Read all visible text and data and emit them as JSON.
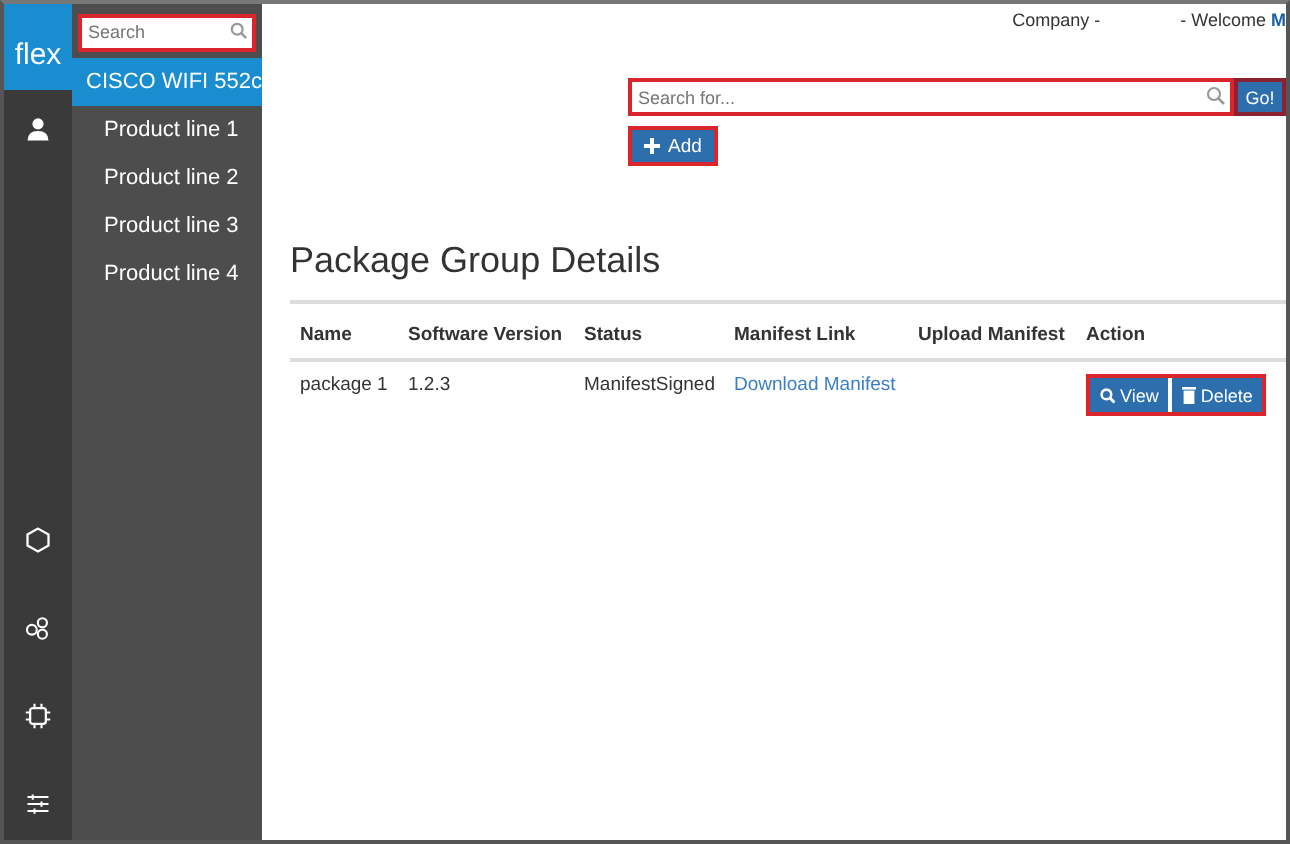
{
  "logo": "flex",
  "rail_icons": [
    {
      "kind": "person"
    },
    {
      "kind": "hexagon"
    },
    {
      "kind": "circles"
    },
    {
      "kind": "chip"
    },
    {
      "kind": "sliders"
    }
  ],
  "sidebar": {
    "search": {
      "placeholder": "Search"
    },
    "items": [
      {
        "label": "CISCO WIFI 552c",
        "selected": true
      },
      {
        "label": "Product line 1",
        "selected": false
      },
      {
        "label": "Product line 2",
        "selected": false
      },
      {
        "label": "Product line 3",
        "selected": false
      },
      {
        "label": "Product line 4",
        "selected": false
      }
    ]
  },
  "header": {
    "company": "Company -",
    "welcome": "- Welcome",
    "user": "M"
  },
  "search": {
    "placeholder": "Search for...",
    "button": "Go!"
  },
  "add_button": "Add",
  "title": "Package Group Details",
  "table": {
    "columns": [
      "Name",
      "Software Version",
      "Status",
      "Manifest Link",
      "Upload Manifest",
      "Action"
    ],
    "rows": [
      {
        "name": "package 1",
        "version": "1.2.3",
        "status": "ManifestSigned",
        "link": "Download Manifest",
        "actions": [
          "View",
          "Delete"
        ]
      }
    ]
  }
}
